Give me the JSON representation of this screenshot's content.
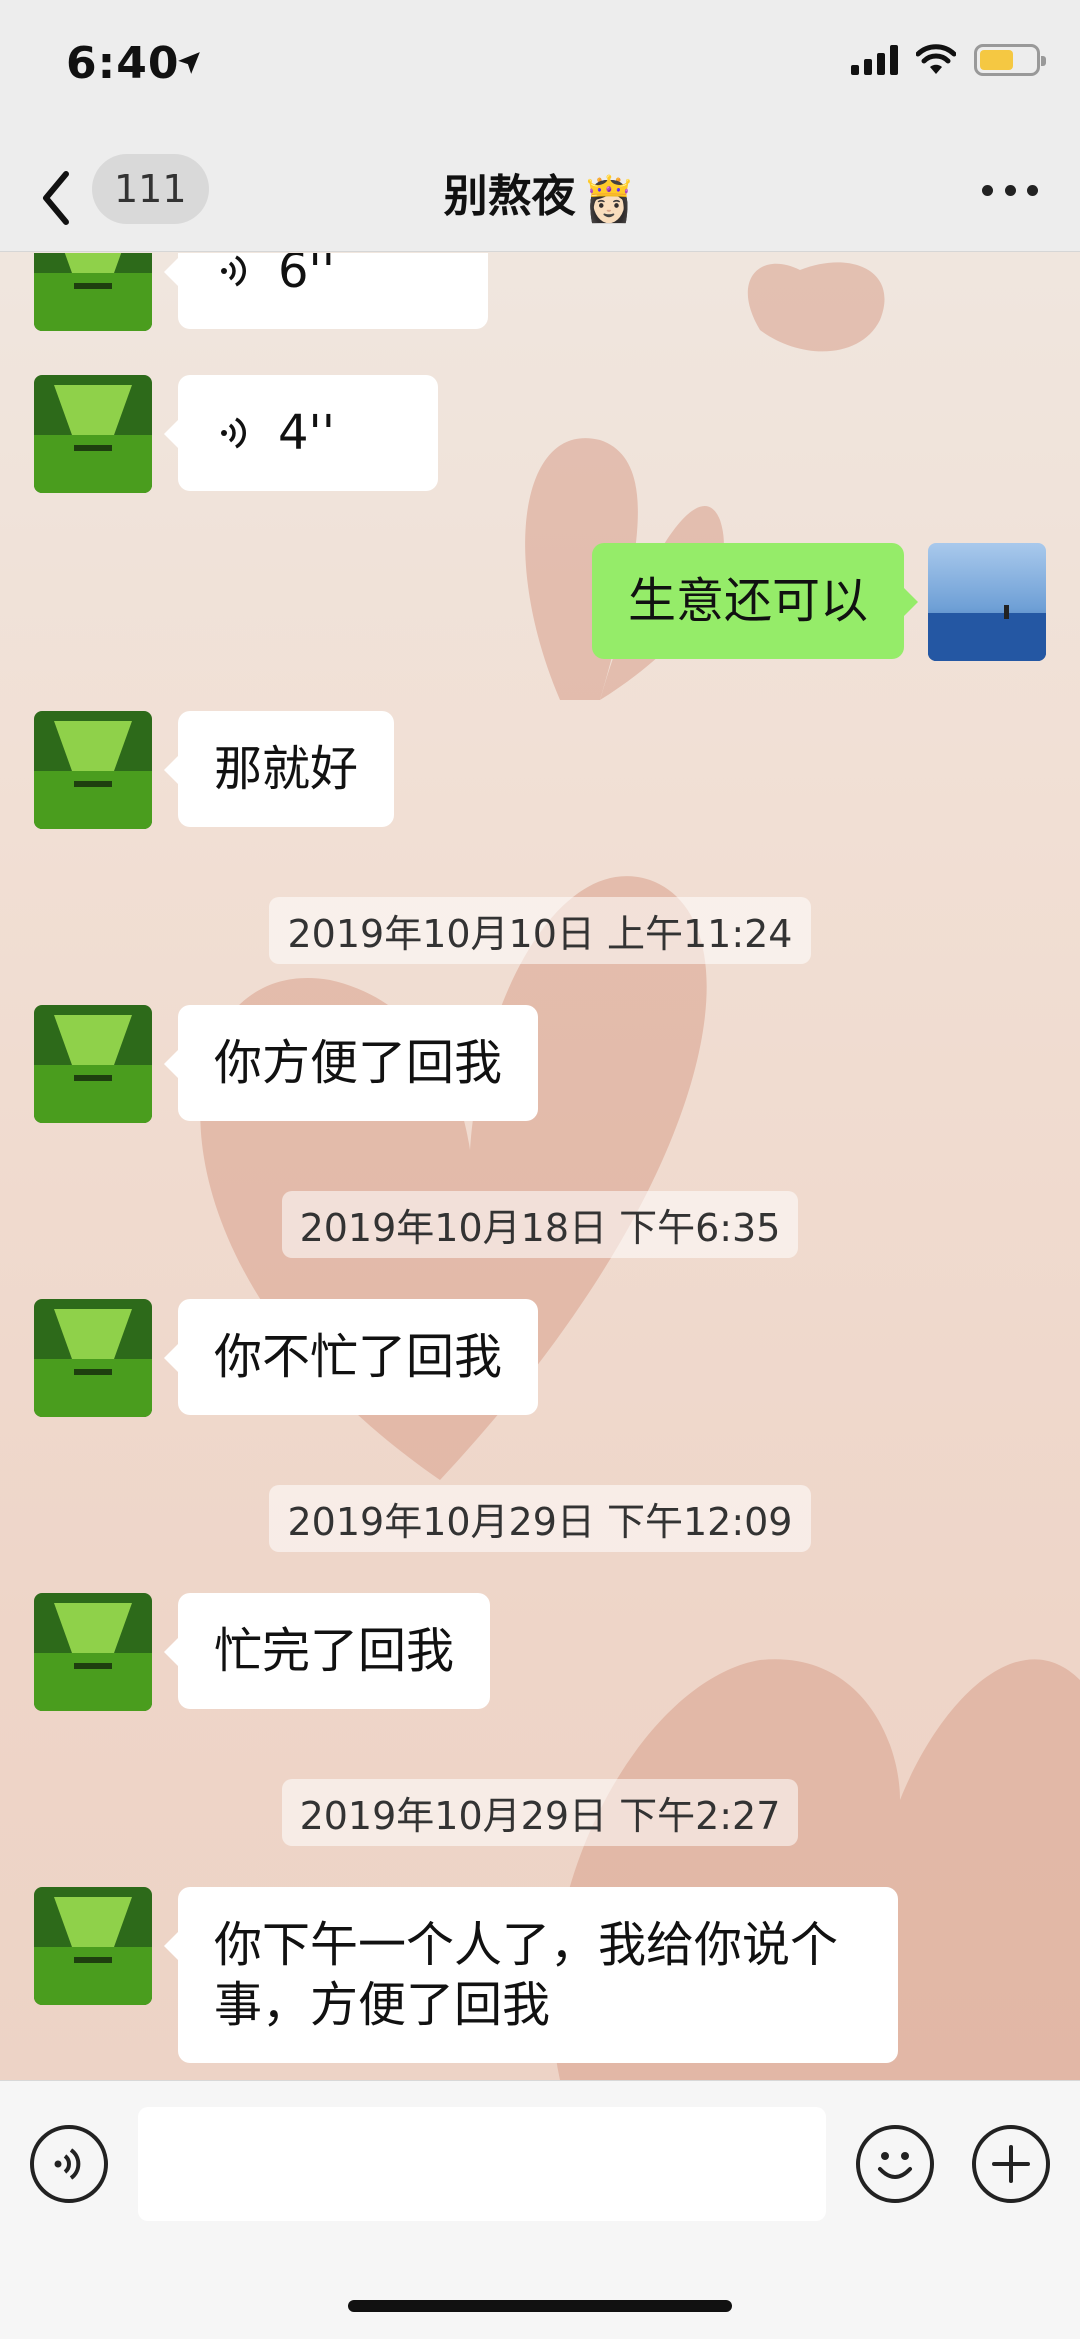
{
  "status_bar": {
    "time": "6:40"
  },
  "header": {
    "back_count": "111",
    "title": "别熬夜",
    "title_emoji": "👸🏻"
  },
  "messages": [
    {
      "side": "left",
      "type": "voice",
      "text": "6''"
    },
    {
      "side": "left",
      "type": "voice",
      "text": "4''"
    },
    {
      "side": "right",
      "type": "text",
      "text": "生意还可以"
    },
    {
      "side": "left",
      "type": "text",
      "text": "那就好"
    },
    {
      "type": "timestamp",
      "text": "2019年10月10日 上午11:24"
    },
    {
      "side": "left",
      "type": "text",
      "text": "你方便了回我"
    },
    {
      "type": "timestamp",
      "text": "2019年10月18日 下午6:35"
    },
    {
      "side": "left",
      "type": "text",
      "text": "你不忙了回我"
    },
    {
      "type": "timestamp",
      "text": "2019年10月29日 下午12:09"
    },
    {
      "side": "left",
      "type": "text",
      "text": "忙完了回我"
    },
    {
      "type": "timestamp",
      "text": "2019年10月29日 下午2:27"
    },
    {
      "side": "left",
      "type": "text",
      "text": "你下午一个人了，我给你说个事，方便了回我"
    }
  ],
  "input": {
    "value": ""
  },
  "icons": [
    "location-arrow-icon",
    "signal-icon",
    "wifi-icon",
    "battery-icon",
    "back-chevron-icon",
    "more-icon",
    "voice-icon",
    "emoji-icon",
    "plus-icon"
  ],
  "colors": {
    "my_bubble": "#95ec69",
    "other_bubble": "#ffffff",
    "header_bg": "#ededed"
  }
}
